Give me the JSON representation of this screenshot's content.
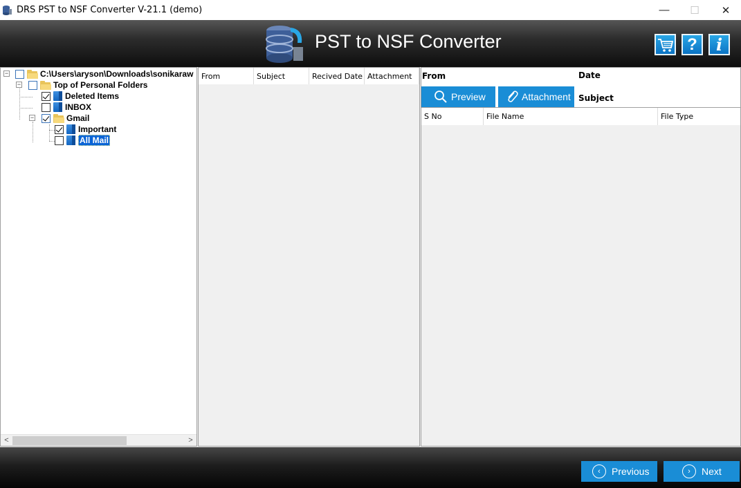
{
  "window": {
    "title": "DRS PST to NSF Converter V-21.1 (demo)",
    "minimize_glyph": "—",
    "maximize_glyph": "☐",
    "close_glyph": "✕"
  },
  "header": {
    "app_title": "PST to NSF Converter",
    "buttons": [
      {
        "name": "cart-icon",
        "glyph": "🛒"
      },
      {
        "name": "help-icon",
        "glyph": "?"
      },
      {
        "name": "info-icon",
        "glyph": "i"
      }
    ],
    "accent_color": "#1a8dd6"
  },
  "tree": {
    "nodes": [
      {
        "label": "C:\\Users\\aryson\\Downloads\\sonikaraw",
        "type": "root-folder",
        "checked": false,
        "expanded": true
      },
      {
        "label": "Top of Personal Folders",
        "type": "folder",
        "checked": false,
        "expanded": true
      },
      {
        "label": "Deleted Items",
        "type": "mailbox",
        "checked": true
      },
      {
        "label": "INBOX",
        "type": "mailbox",
        "checked": false
      },
      {
        "label": "Gmail",
        "type": "folder",
        "checked": true,
        "expanded": true
      },
      {
        "label": "Important",
        "type": "mailbox",
        "checked": true
      },
      {
        "label": "All Mail",
        "type": "mailbox",
        "checked": false,
        "selected": true
      }
    ],
    "scroll_left": "<",
    "scroll_right": ">"
  },
  "mail_list": {
    "columns": [
      "From",
      "Subject",
      "Recived Date",
      "Attachment"
    ]
  },
  "detail": {
    "from_label": "From",
    "date_label": "Date",
    "subject_label": "Subject",
    "preview_button": "Preview",
    "attachment_button": "Attachment",
    "attachment_columns": [
      "S No",
      "File Name",
      "File Type"
    ]
  },
  "footer": {
    "previous_button": "Previous",
    "next_button": "Next",
    "previous_glyph": "‹",
    "next_glyph": "›"
  }
}
